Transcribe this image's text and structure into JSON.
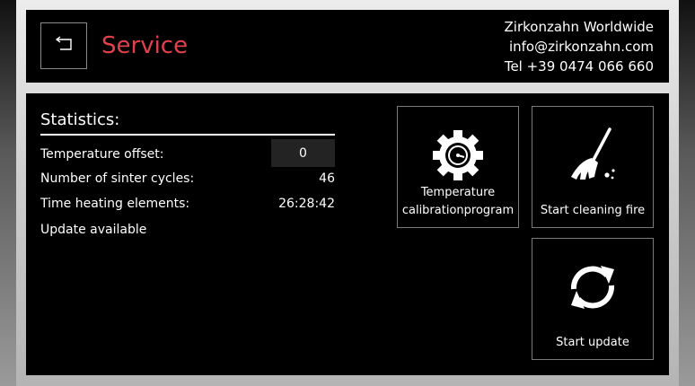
{
  "header": {
    "title": "Service",
    "back_icon": "back-arrow-icon",
    "contact": {
      "company": "Zirkonzahn Worldwide",
      "email": "info@zirkonzahn.com",
      "phone": "Tel +39 0474 066 660"
    }
  },
  "statistics": {
    "title": "Statistics:",
    "temperature_offset": {
      "label": "Temperature offset:",
      "value": "0"
    },
    "sinter_cycles": {
      "label": "Number of sinter cycles:",
      "value": "46"
    },
    "heating_time": {
      "label": "Time heating elements:",
      "value": "26:28:42"
    },
    "update_status": "Update available"
  },
  "tiles": {
    "calibration": {
      "label_line1": "Temperature",
      "label_line2": "calibrationprogram",
      "icon": "gear-gauge-icon"
    },
    "cleaning": {
      "label": "Start cleaning fire",
      "icon": "broom-icon"
    },
    "update": {
      "label": "Start update",
      "icon": "sync-icon"
    }
  },
  "colors": {
    "title_accent": "#e0424c",
    "background": "#000000",
    "input_background": "#232323"
  }
}
